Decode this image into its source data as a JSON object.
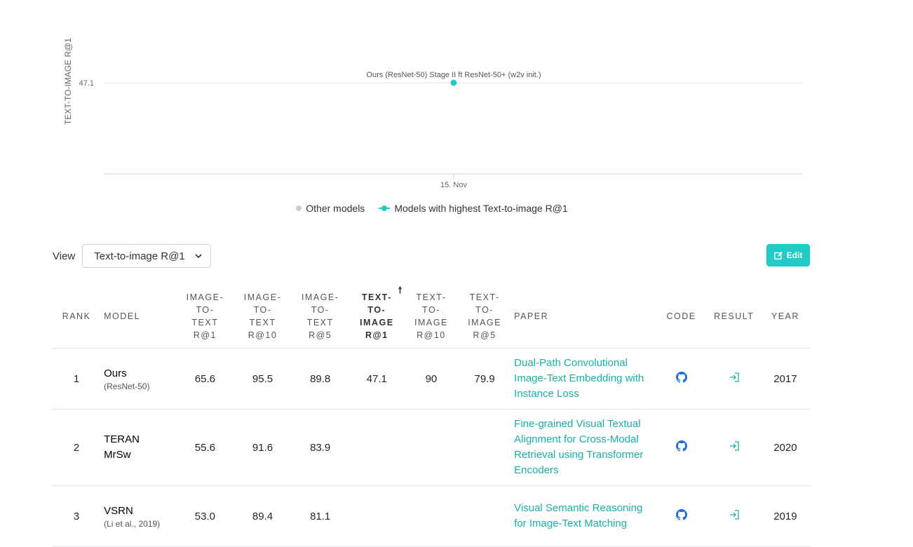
{
  "chart_data": {
    "type": "scatter",
    "ylabel": "TEXT-TO-IMAGE R@1",
    "yticks": [
      "47.1"
    ],
    "xticks": [
      "15. Nov"
    ],
    "points": [
      {
        "x": "15. Nov",
        "y": 47.1,
        "label": "Ours (ResNet-50) Stage II ft ResNet-50+ (w2v init.)",
        "series": "Models with highest Text-to-image R@1"
      }
    ],
    "series": [
      {
        "name": "Other models",
        "color": "#cccccc"
      },
      {
        "name": "Models with highest Text-to-image R@1",
        "color": "#21ccc7"
      }
    ]
  },
  "legend": {
    "other": "Other models",
    "best": "Models with highest Text-to-image R@1"
  },
  "view": {
    "label": "View",
    "selected": "Text-to-image R@1"
  },
  "edit_label": "Edit",
  "table": {
    "headers": {
      "rank": "RANK",
      "model": "MODEL",
      "i2t1": [
        "IMAGE-",
        "TO-",
        "TEXT",
        "R@1"
      ],
      "i2t10": [
        "IMAGE-",
        "TO-",
        "TEXT",
        "R@10"
      ],
      "i2t5": [
        "IMAGE-",
        "TO-",
        "TEXT",
        "R@5"
      ],
      "t2i1": [
        "TEXT-",
        "TO-",
        "IMAGE",
        "R@1"
      ],
      "t2i10": [
        "TEXT-",
        "TO-",
        "IMAGE",
        "R@10"
      ],
      "t2i5": [
        "TEXT-",
        "TO-",
        "IMAGE",
        "R@5"
      ],
      "paper": "PAPER",
      "code": "CODE",
      "result": "RESULT",
      "year": "YEAR"
    },
    "rows": [
      {
        "rank": "1",
        "model": "Ours",
        "model_sub": "(ResNet-50)",
        "i2t1": "65.6",
        "i2t10": "95.5",
        "i2t5": "89.8",
        "t2i1": "47.1",
        "t2i10": "90",
        "t2i5": "79.9",
        "paper": "Dual-Path Convolutional Image-Text Embedding with Instance Loss",
        "year": "2017"
      },
      {
        "rank": "2",
        "model": "TERAN MrSw",
        "model_sub": "",
        "i2t1": "55.6",
        "i2t10": "91.6",
        "i2t5": "83.9",
        "t2i1": "",
        "t2i10": "",
        "t2i5": "",
        "paper": "Fine-grained Visual Textual Alignment for Cross-Modal Retrieval using Transformer Encoders",
        "year": "2020"
      },
      {
        "rank": "3",
        "model": "VSRN",
        "model_sub": "(Li et al., 2019)",
        "i2t1": "53.0",
        "i2t10": "89.4",
        "i2t5": "81.1",
        "t2i1": "",
        "t2i10": "",
        "t2i5": "",
        "paper": "Visual Semantic Reasoning for Image-Text Matching",
        "year": "2019"
      }
    ]
  }
}
